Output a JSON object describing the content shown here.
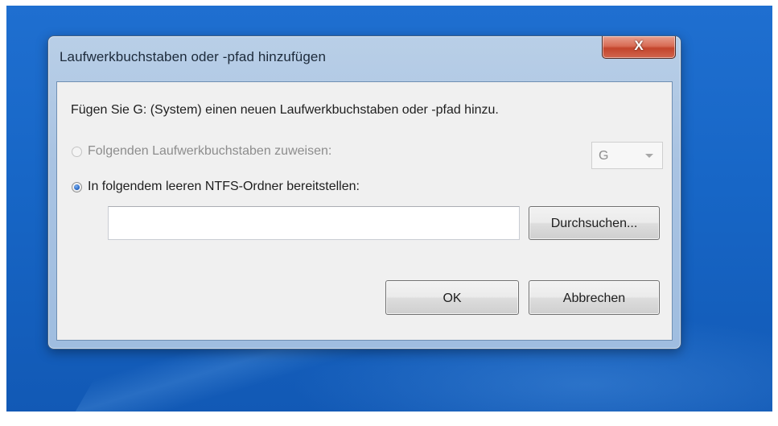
{
  "window": {
    "title": "Laufwerkbuchstaben oder -pfad hinzufügen",
    "close_glyph": "X"
  },
  "dialog": {
    "prompt": "Fügen Sie G: (System) einen neuen Laufwerkbuchstaben oder -pfad hinzu.",
    "option_assign_letter": {
      "label": "Folgenden Laufwerkbuchstaben zuweisen:",
      "selected": false,
      "enabled": false
    },
    "drive_letter_select": {
      "value": "G",
      "enabled": false
    },
    "option_mount_folder": {
      "label": "In folgendem leeren NTFS-Ordner bereitstellen:",
      "selected": true,
      "enabled": true
    },
    "folder_path": {
      "value": "",
      "placeholder": ""
    },
    "browse_label": "Durchsuchen...",
    "ok_label": "OK",
    "cancel_label": "Abbrechen"
  },
  "icons": {
    "close": "close-icon",
    "dropdown": "chevron-down-icon"
  }
}
